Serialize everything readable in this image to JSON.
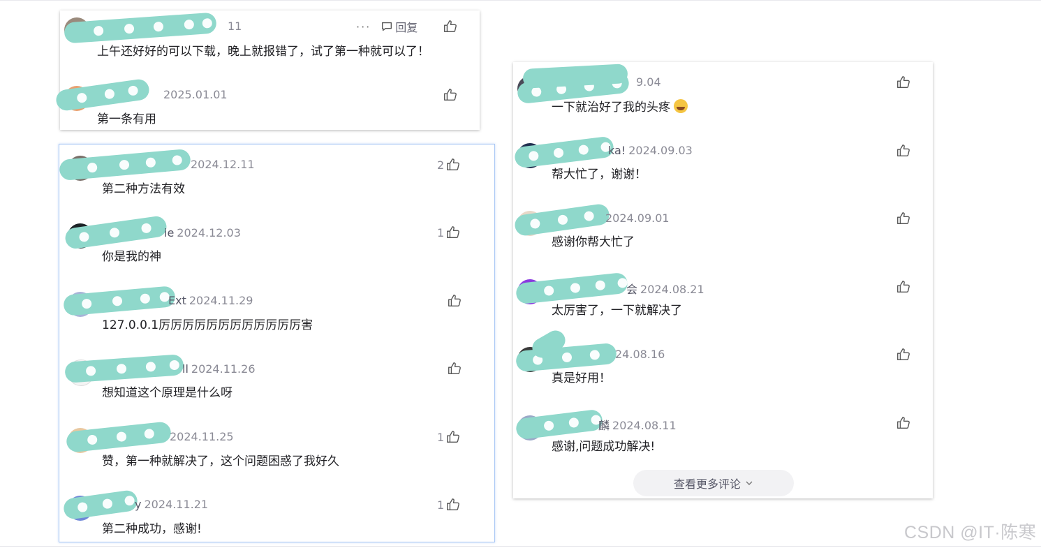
{
  "top_card": {
    "more_label": "···",
    "reply_label": "回复",
    "comments": [
      {
        "name": "",
        "date": "",
        "name_suffix": "",
        "date_suffix": "11",
        "text": "上午还好好的可以下载，晚上就报错了，试了第一种就可以了！",
        "likes": ""
      },
      {
        "name": "",
        "date": "2025.01.01",
        "text": "第一条有用",
        "likes": ""
      }
    ]
  },
  "left_card": {
    "comments": [
      {
        "name": "",
        "date": "2024.12.11",
        "text": "第二种方法有效",
        "likes": "2"
      },
      {
        "name": "ie",
        "date": "2024.12.03",
        "text": "你是我的神",
        "likes": "1"
      },
      {
        "name": "Ext",
        "date": "2024.11.29",
        "text": "127.0.0.1厉厉厉厉厉厉厉厉厉厉厉厉害",
        "likes": ""
      },
      {
        "name": "ll",
        "date": "2024.11.26",
        "text": "想知道这个原理是什么呀",
        "likes": ""
      },
      {
        "name": "",
        "date": "2024.11.25",
        "text": "赞，第一种就解决了，这个问题困惑了我好久",
        "likes": "1"
      },
      {
        "name": "y",
        "date": "2024.11.21",
        "text": "第二种成功，感谢!",
        "likes": "1"
      }
    ]
  },
  "right_card": {
    "view_more_label": "查看更多评论",
    "comments": [
      {
        "name": "",
        "date": "9.04",
        "text": "一下就治好了我的头疼",
        "likes": ""
      },
      {
        "name": "ka!",
        "date": "2024.09.03",
        "text": "帮大忙了，谢谢！",
        "likes": ""
      },
      {
        "name": "",
        "date": "2024.09.01",
        "text": "感谢你帮大忙了",
        "likes": ""
      },
      {
        "name": "会",
        "date": "2024.08.21",
        "text": "太厉害了，一下就解决了",
        "likes": ""
      },
      {
        "name": "",
        "date": "24.08.16",
        "text": "真是好用！",
        "likes": ""
      },
      {
        "name": "麟",
        "date": "2024.08.11",
        "text": "感谢,问题成功解决!",
        "likes": ""
      }
    ]
  },
  "watermark": "CSDN @IT·陈寒",
  "icons": {
    "like": "thumbs-up-icon",
    "reply": "comment-bubble-icon",
    "more": "more-dots-icon",
    "expand": "chevron-down-icon",
    "emoji": "grinning-emoji-icon"
  },
  "colors": {
    "redaction": "#8fd8cb",
    "selected_border": "#a9c7f5",
    "meta_text": "#8a8a95"
  }
}
